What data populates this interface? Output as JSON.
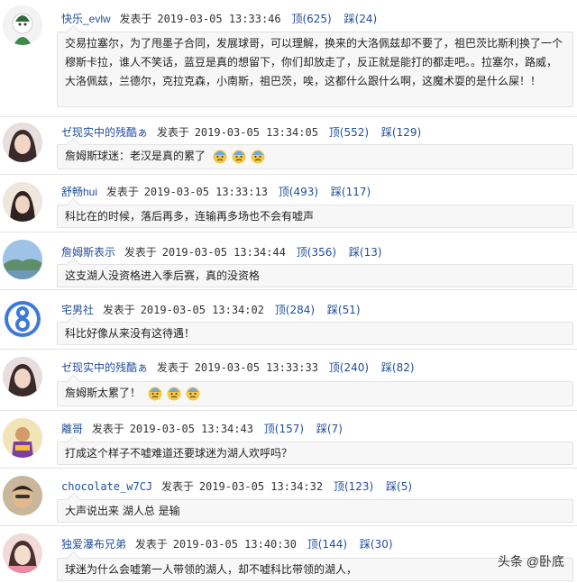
{
  "comments": [
    {
      "user": "快乐_evlw",
      "posted": "发表于",
      "time": "2019-03-05 13:33:46",
      "up": "顶(625)",
      "down": "踩(24)",
      "text": "交易拉塞尔，为了甩墨子合同，发展球哥，可以理解，换来的大洛佩兹却不要了，祖巴茨比斯利换了一个穆斯卡拉，谁人不笑话，蓝豆是真的想留下，你们却放走了，反正就是能打的都走吧。。拉塞尔，路威，大洛佩兹，兰德尔，克拉克森，小南斯，祖巴茨，唉，这都什么跟什么啊，这魔术耍的是什么屎！！"
    },
    {
      "user": "ゼ现实中的残酷ぁ",
      "posted": "发表于",
      "time": "2019-03-05 13:34:05",
      "up": "顶(552)",
      "down": "踩(129)",
      "text": "詹姆斯球迷：老汉是真的累了"
    },
    {
      "user": "舒畅hui",
      "posted": "发表于",
      "time": "2019-03-05 13:33:13",
      "up": "顶(493)",
      "down": "踩(117)",
      "text": "科比在的时候，落后再多，连输再多场也不会有嘘声"
    },
    {
      "user": "詹姆斯表示",
      "posted": "发表于",
      "time": "2019-03-05 13:34:44",
      "up": "顶(356)",
      "down": "踩(13)",
      "text": "这支湖人没资格进入季后赛，真的没资格"
    },
    {
      "user": "宅男社",
      "posted": "发表于",
      "time": "2019-03-05 13:34:02",
      "up": "顶(284)",
      "down": "踩(51)",
      "text": "科比好像从来没有这待遇！"
    },
    {
      "user": "ゼ现实中的残酷ぁ",
      "posted": "发表于",
      "time": "2019-03-05 13:33:33",
      "up": "顶(240)",
      "down": "踩(82)",
      "text": "詹姆斯太累了！"
    },
    {
      "user": "離哥",
      "posted": "发表于",
      "time": "2019-03-05 13:34:43",
      "up": "顶(157)",
      "down": "踩(7)",
      "text": "打成这个样子不嘘难道还要球迷为湖人欢呼吗？"
    },
    {
      "user": "chocolate_w7CJ",
      "posted": "发表于",
      "time": "2019-03-05 13:34:32",
      "up": "顶(123)",
      "down": "踩(5)",
      "text": "大声说出来 湖人总 是输"
    },
    {
      "user": "独爱瀑布兄弟",
      "posted": "发表于",
      "time": "2019-03-05 13:40:30",
      "up": "顶(144)",
      "down": "踩(30)",
      "text": "球迷为什么会嘘第一人带领的湖人，却不嘘科比带领的湖人，"
    }
  ],
  "watermark": "头条 @卧底",
  "colors": {
    "username": "#1f4e9c",
    "bubble_bg": "#f7f7f7",
    "border": "#e3e3e3"
  }
}
